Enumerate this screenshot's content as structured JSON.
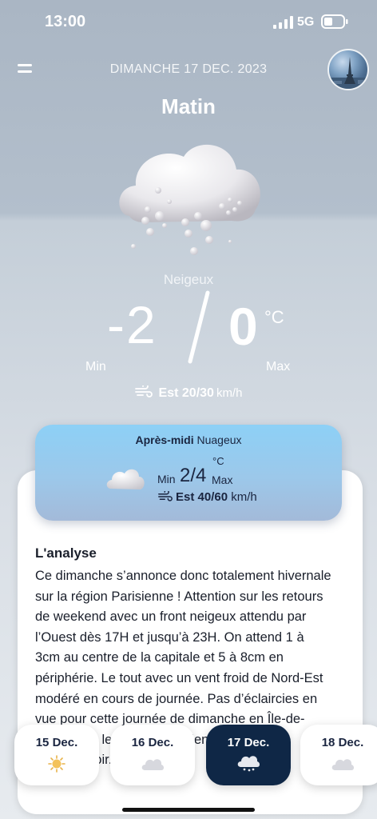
{
  "status_bar": {
    "time": "13:00",
    "network": "5G"
  },
  "header": {
    "date": "DIMANCHE 17 DEC. 2023",
    "period": "Matin"
  },
  "main": {
    "condition": "Neigeux",
    "temp_min": "-2",
    "temp_max": "0",
    "unit": "°C",
    "min_label": "Min",
    "max_label": "Max",
    "wind_direction": "Est",
    "wind_speed": "20/30",
    "wind_unit": "km/h"
  },
  "afternoon": {
    "title": "Après-midi",
    "condition": "Nuageux",
    "min_label": "Min",
    "temps": "2/4",
    "unit": "°C",
    "max_label": "Max",
    "wind_direction": "Est",
    "wind_speed": "40/60",
    "wind_unit": "km/h"
  },
  "analysis": {
    "title": "L'analyse",
    "text": "Ce dimanche s’annonce donc totalement hivernale sur la région Parisienne ! Attention sur  les retours de weekend avec un front neigeux attendu par l’Ouest dès 17H et jusqu’à 23H.  On attend 1 à 3cm au centre de la capitale et 5 à 8cm en périphérie.  Le tout avec un vent froid de Nord-Est modéré en cours de journée. Pas d’éclaircies en vue  pour cette journée de dimanche en Île-de-France, où le ciel restera bien gris du matin jusqu’au soir."
  },
  "days": [
    {
      "label": "15 Dec.",
      "icon": "sun-icon",
      "active": false
    },
    {
      "label": "16 Dec.",
      "icon": "cloud-icon",
      "active": false
    },
    {
      "label": "17 Dec.",
      "icon": "snow-cloud-icon",
      "active": true
    },
    {
      "label": "18 Dec.",
      "icon": "cloud-icon",
      "active": false
    }
  ],
  "colors": {
    "active_day": "#0f2746",
    "afternoon_top": "#8dd0f6",
    "text_dark": "#1a1f2b"
  }
}
